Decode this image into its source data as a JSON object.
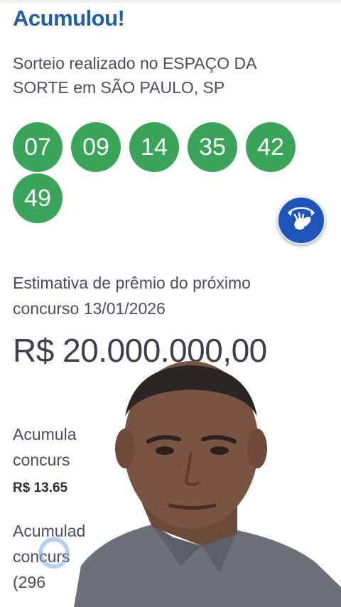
{
  "result": {
    "title": "Acumulou!",
    "draw_line1": "Sorteio realizado no ESPAÇO DA",
    "draw_line2": "SORTE em SÃO PAULO, SP",
    "numbers": [
      "07",
      "09",
      "14",
      "35",
      "42",
      "49"
    ]
  },
  "next": {
    "estimate_line1": "Estimativa de prêmio do próximo",
    "estimate_line2": "concurso 13/01/2026",
    "prize": "R$ 20.000.000,00"
  },
  "accumulated": [
    {
      "line1": "Acumula",
      "line2": "concurs",
      "value": "R$ 13.65"
    },
    {
      "line1": "Acumulad",
      "line2": "concurs",
      "line3": "(296"
    }
  ],
  "icons": {
    "accessibility": "sign-language-icon",
    "loading": "loading-spinner-icon"
  },
  "colors": {
    "title": "#1f5fa6",
    "ball": "#3aa55a",
    "accessibility_button": "#1d55b8"
  }
}
